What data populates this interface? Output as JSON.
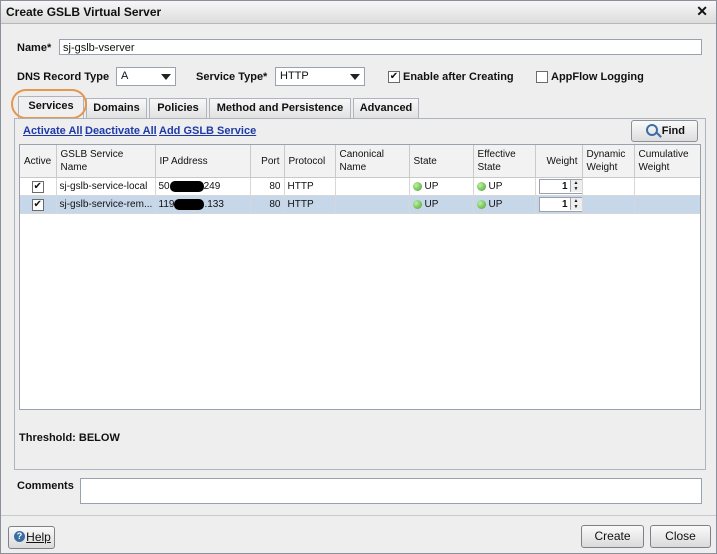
{
  "window": {
    "title": "Create GSLB Virtual Server"
  },
  "form": {
    "name_label": "Name*",
    "name_value": "sj-gslb-vserver",
    "dns_label": "DNS Record Type",
    "dns_value": "A",
    "service_type_label": "Service Type*",
    "service_type_value": "HTTP",
    "enable_label": "Enable after Creating",
    "enable_checked": true,
    "appflow_label": "AppFlow Logging",
    "appflow_checked": false
  },
  "tabs": [
    {
      "label": "Services",
      "active": true
    },
    {
      "label": "Domains"
    },
    {
      "label": "Policies"
    },
    {
      "label": "Method and Persistence"
    },
    {
      "label": "Advanced"
    }
  ],
  "actions": {
    "activate_all": "Activate All",
    "deactivate_all": "Deactivate All",
    "add_service": "Add GSLB Service",
    "find": "Find"
  },
  "table": {
    "headers": [
      "Active",
      "GSLB Service Name",
      "IP Address",
      "Port",
      "Protocol",
      "Canonical Name",
      "State",
      "Effective State",
      "Weight",
      "Dynamic Weight",
      "Cumulative Weight"
    ],
    "rows": [
      {
        "active": "✔",
        "name": "sj-gslb-service-local",
        "ip_prefix": "50",
        "ip_suffix": "249",
        "port": "80",
        "protocol": "HTTP",
        "canonical": "",
        "state": "UP",
        "effective": "UP",
        "weight": "1"
      },
      {
        "active": "✔",
        "name": "sj-gslb-service-rem...",
        "ip_prefix": "119",
        "ip_suffix": ".133",
        "port": "80",
        "protocol": "HTTP",
        "canonical": "",
        "state": "UP",
        "effective": "UP",
        "weight": "1"
      }
    ]
  },
  "threshold": "Threshold: BELOW",
  "comments": {
    "label": "Comments",
    "value": ""
  },
  "buttons": {
    "help": "Help",
    "create": "Create",
    "close": "Close"
  }
}
